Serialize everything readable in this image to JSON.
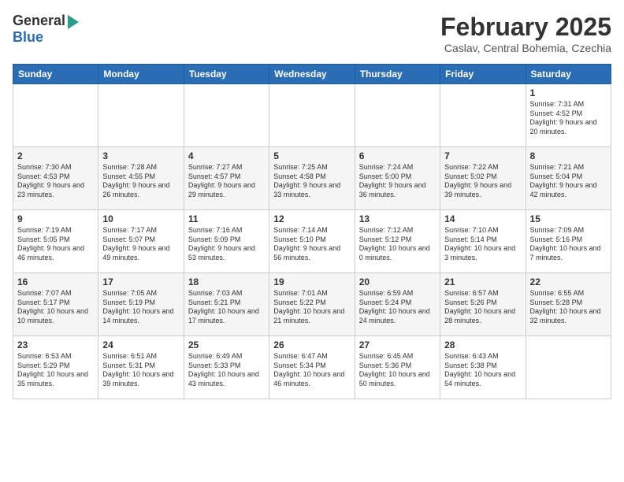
{
  "header": {
    "logo_general": "General",
    "logo_blue": "Blue",
    "month_title": "February 2025",
    "location": "Caslav, Central Bohemia, Czechia"
  },
  "days_of_week": [
    "Sunday",
    "Monday",
    "Tuesday",
    "Wednesday",
    "Thursday",
    "Friday",
    "Saturday"
  ],
  "weeks": [
    [
      {
        "day": "",
        "info": ""
      },
      {
        "day": "",
        "info": ""
      },
      {
        "day": "",
        "info": ""
      },
      {
        "day": "",
        "info": ""
      },
      {
        "day": "",
        "info": ""
      },
      {
        "day": "",
        "info": ""
      },
      {
        "day": "1",
        "info": "Sunrise: 7:31 AM\nSunset: 4:52 PM\nDaylight: 9 hours and 20 minutes."
      }
    ],
    [
      {
        "day": "2",
        "info": "Sunrise: 7:30 AM\nSunset: 4:53 PM\nDaylight: 9 hours and 23 minutes."
      },
      {
        "day": "3",
        "info": "Sunrise: 7:28 AM\nSunset: 4:55 PM\nDaylight: 9 hours and 26 minutes."
      },
      {
        "day": "4",
        "info": "Sunrise: 7:27 AM\nSunset: 4:57 PM\nDaylight: 9 hours and 29 minutes."
      },
      {
        "day": "5",
        "info": "Sunrise: 7:25 AM\nSunset: 4:58 PM\nDaylight: 9 hours and 33 minutes."
      },
      {
        "day": "6",
        "info": "Sunrise: 7:24 AM\nSunset: 5:00 PM\nDaylight: 9 hours and 36 minutes."
      },
      {
        "day": "7",
        "info": "Sunrise: 7:22 AM\nSunset: 5:02 PM\nDaylight: 9 hours and 39 minutes."
      },
      {
        "day": "8",
        "info": "Sunrise: 7:21 AM\nSunset: 5:04 PM\nDaylight: 9 hours and 42 minutes."
      }
    ],
    [
      {
        "day": "9",
        "info": "Sunrise: 7:19 AM\nSunset: 5:05 PM\nDaylight: 9 hours and 46 minutes."
      },
      {
        "day": "10",
        "info": "Sunrise: 7:17 AM\nSunset: 5:07 PM\nDaylight: 9 hours and 49 minutes."
      },
      {
        "day": "11",
        "info": "Sunrise: 7:16 AM\nSunset: 5:09 PM\nDaylight: 9 hours and 53 minutes."
      },
      {
        "day": "12",
        "info": "Sunrise: 7:14 AM\nSunset: 5:10 PM\nDaylight: 9 hours and 56 minutes."
      },
      {
        "day": "13",
        "info": "Sunrise: 7:12 AM\nSunset: 5:12 PM\nDaylight: 10 hours and 0 minutes."
      },
      {
        "day": "14",
        "info": "Sunrise: 7:10 AM\nSunset: 5:14 PM\nDaylight: 10 hours and 3 minutes."
      },
      {
        "day": "15",
        "info": "Sunrise: 7:09 AM\nSunset: 5:16 PM\nDaylight: 10 hours and 7 minutes."
      }
    ],
    [
      {
        "day": "16",
        "info": "Sunrise: 7:07 AM\nSunset: 5:17 PM\nDaylight: 10 hours and 10 minutes."
      },
      {
        "day": "17",
        "info": "Sunrise: 7:05 AM\nSunset: 5:19 PM\nDaylight: 10 hours and 14 minutes."
      },
      {
        "day": "18",
        "info": "Sunrise: 7:03 AM\nSunset: 5:21 PM\nDaylight: 10 hours and 17 minutes."
      },
      {
        "day": "19",
        "info": "Sunrise: 7:01 AM\nSunset: 5:22 PM\nDaylight: 10 hours and 21 minutes."
      },
      {
        "day": "20",
        "info": "Sunrise: 6:59 AM\nSunset: 5:24 PM\nDaylight: 10 hours and 24 minutes."
      },
      {
        "day": "21",
        "info": "Sunrise: 6:57 AM\nSunset: 5:26 PM\nDaylight: 10 hours and 28 minutes."
      },
      {
        "day": "22",
        "info": "Sunrise: 6:55 AM\nSunset: 5:28 PM\nDaylight: 10 hours and 32 minutes."
      }
    ],
    [
      {
        "day": "23",
        "info": "Sunrise: 6:53 AM\nSunset: 5:29 PM\nDaylight: 10 hours and 35 minutes."
      },
      {
        "day": "24",
        "info": "Sunrise: 6:51 AM\nSunset: 5:31 PM\nDaylight: 10 hours and 39 minutes."
      },
      {
        "day": "25",
        "info": "Sunrise: 6:49 AM\nSunset: 5:33 PM\nDaylight: 10 hours and 43 minutes."
      },
      {
        "day": "26",
        "info": "Sunrise: 6:47 AM\nSunset: 5:34 PM\nDaylight: 10 hours and 46 minutes."
      },
      {
        "day": "27",
        "info": "Sunrise: 6:45 AM\nSunset: 5:36 PM\nDaylight: 10 hours and 50 minutes."
      },
      {
        "day": "28",
        "info": "Sunrise: 6:43 AM\nSunset: 5:38 PM\nDaylight: 10 hours and 54 minutes."
      },
      {
        "day": "",
        "info": ""
      }
    ]
  ]
}
